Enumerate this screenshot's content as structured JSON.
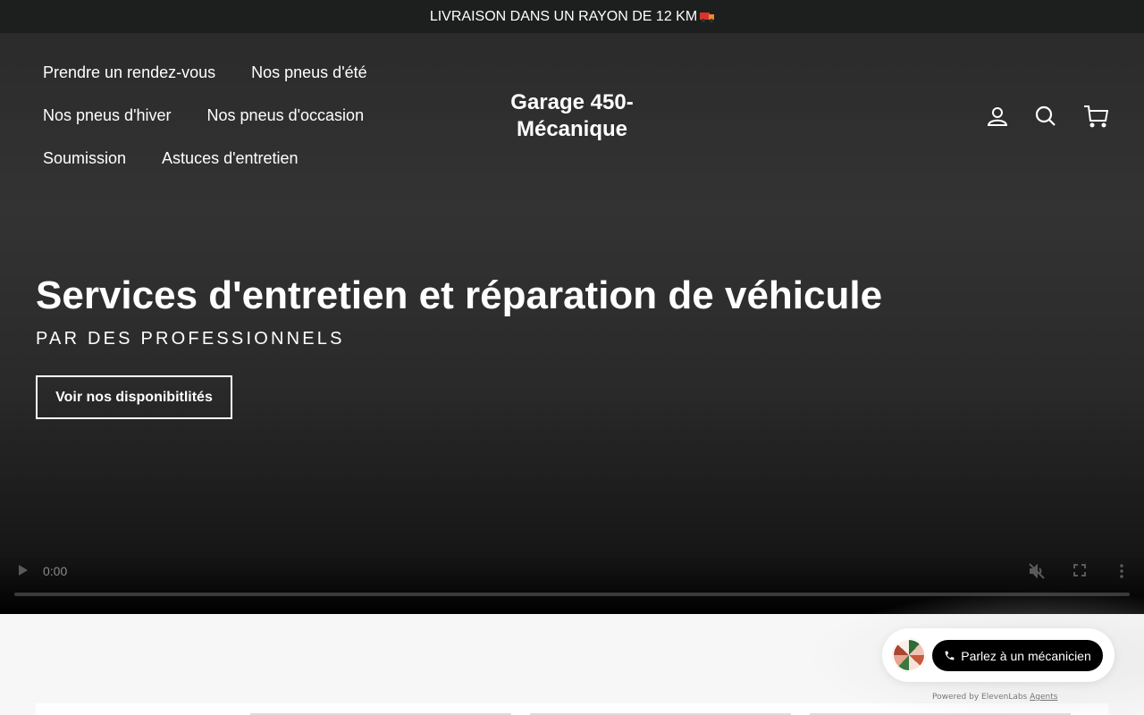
{
  "announcement": {
    "text": "LIVRAISON DANS UN RAYON DE 12 KM",
    "emoji_icon": "truck-icon"
  },
  "header": {
    "nav": [
      [
        "Prendre un rendez-vous",
        "Nos pneus d'été"
      ],
      [
        "Nos pneus d'hiver",
        "Nos pneus d'occasion"
      ],
      [
        "Soumission",
        "Astuces d'entretien"
      ]
    ],
    "logo_line1": "Garage 450-",
    "logo_line2": "Mécanique",
    "icons": [
      "account-icon",
      "search-icon",
      "cart-icon"
    ]
  },
  "hero": {
    "title": "Services d'entretien et réparation de véhicule",
    "subtitle": "PAR DES PROFESSIONNELS",
    "button": "Voir nos disponibitlités"
  },
  "video": {
    "time": "0:00",
    "progress": 0
  },
  "widget": {
    "call_label": "Parlez à un mécanicien",
    "powered_prefix": "Powered by ElevenLabs",
    "powered_link": "Agents"
  },
  "colors": {
    "announce_bg": "#1d1e1e",
    "hero_bg": "#333333",
    "button_border": "#ffffff",
    "call_button": "#000000"
  }
}
